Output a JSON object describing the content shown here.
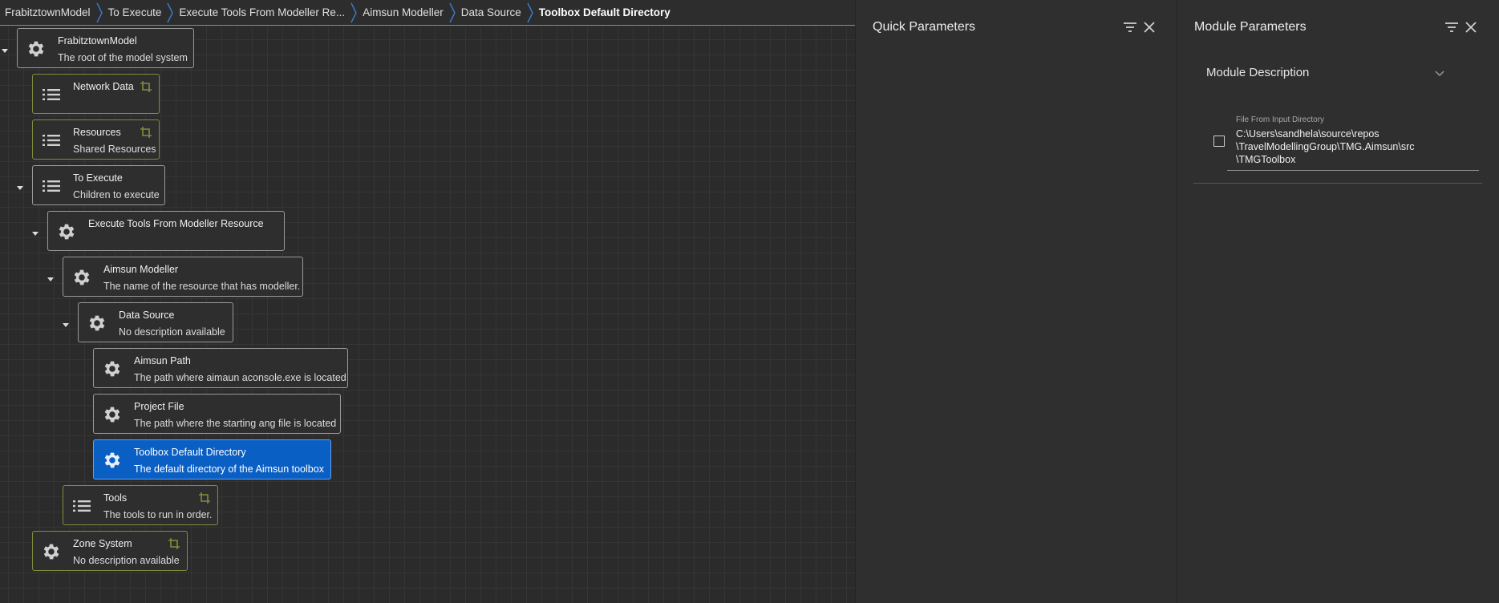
{
  "breadcrumb": [
    {
      "label": "FrabitztownModel"
    },
    {
      "label": "To Execute"
    },
    {
      "label": "Execute Tools From Modeller Re..."
    },
    {
      "label": "Aimsun Modeller"
    },
    {
      "label": "Data Source"
    },
    {
      "label": "Toolbox Default Directory"
    }
  ],
  "nodes": [
    {
      "title": "FrabitztownModel",
      "desc": "The root of the model system"
    },
    {
      "title": "Network Data",
      "desc": ""
    },
    {
      "title": "Resources",
      "desc": "Shared Resources"
    },
    {
      "title": "To Execute",
      "desc": "Children to execute"
    },
    {
      "title": "Execute Tools From Modeller Resource",
      "desc": ""
    },
    {
      "title": "Aimsun Modeller",
      "desc": "The name of the resource that has modeller."
    },
    {
      "title": "Data Source",
      "desc": "No description available"
    },
    {
      "title": "Aimsun Path",
      "desc": "The path where aimaun aconsole.exe is located"
    },
    {
      "title": "Project File",
      "desc": "The path where the starting ang file is located"
    },
    {
      "title": "Toolbox Default Directory",
      "desc": "The default directory of the Aimsun toolbox",
      "selected": true
    },
    {
      "title": "Tools",
      "desc": "The tools to run in order."
    },
    {
      "title": "Zone System",
      "desc": "No description available"
    }
  ],
  "icons": {
    "module": "gear-icon",
    "collection": "list-icon",
    "link": "crop-icon",
    "expand": "caret-down-icon"
  },
  "quick_parameters": {
    "title": "Quick Parameters"
  },
  "module_parameters": {
    "title": "Module Parameters",
    "description_header": "Module Description",
    "parameters": [
      {
        "label": "File From Input Directory",
        "value_lines": [
          "C:\\Users\\sandhela\\source\\repos",
          "\\TravelModellingGroup\\TMG.Aimsun\\src",
          "\\TMGToolbox"
        ],
        "checked": false
      }
    ]
  },
  "colors": {
    "selected_node": "#0a5fc4",
    "linked_border": "#7d8f3c",
    "background": "#2d2d2d"
  }
}
